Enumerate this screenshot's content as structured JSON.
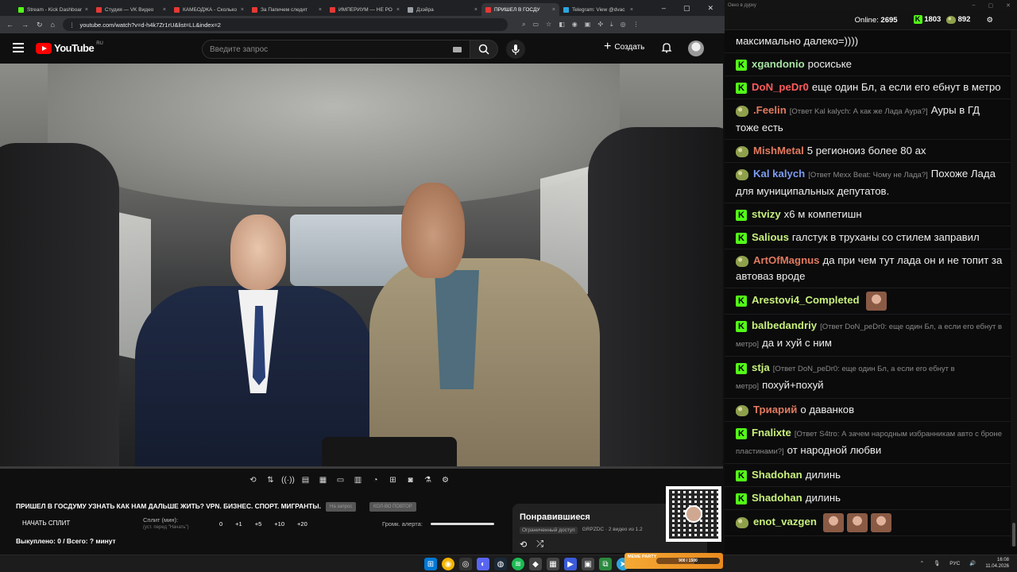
{
  "browser": {
    "tabs": [
      {
        "title": "Stream - Kick Dashboard",
        "color": "#53fc18",
        "active": false
      },
      {
        "title": "Студия — VK Видео",
        "color": "#e53935",
        "active": false
      },
      {
        "title": "КАМБОДЖА - Сколько",
        "color": "#e53935",
        "active": false
      },
      {
        "title": "За Папичем следит",
        "color": "#e53935",
        "active": false
      },
      {
        "title": "ИМПЕРИУМ — НЕ РО",
        "color": "#e53935",
        "active": false
      },
      {
        "title": "Дзэйра",
        "color": "#9aa0a6",
        "active": false
      },
      {
        "title": "ПРИШЕЛ В ГОСДУ",
        "color": "#e53935",
        "active": true
      },
      {
        "title": "Telegram: View @dvac",
        "color": "#2ca5e0",
        "active": false
      }
    ],
    "url": "youtube.com/watch?v=d-h4k7Zr1rU&list=LL&index=2"
  },
  "youtube": {
    "logo_text": "YouTube",
    "region": "RU",
    "search_placeholder": "Введите запрос",
    "create_label": "Создать"
  },
  "player": {
    "title": "ПРИШЕЛ В ГОСДУМУ УЗНАТЬ КАК НАМ ДАЛЬШЕ ЖИТЬ? VPN. БИЗНЕС. СПОРТ. МИГРАНТЫ.",
    "btn_ghost1": "На запрос",
    "btn_ghost2": "КОЛ-ВО ПОВТОР",
    "split_button": "НАЧАТЬ СПЛИТ",
    "split_label": "Сплит (мин):",
    "split_sub": "(уст. перед \"Начать\")",
    "split_values": [
      "0",
      "+1",
      "+5",
      "+10",
      "+20"
    ],
    "alert_label": "Громк. алерта:",
    "bought": "Выкуплено: 0 / Всего: ? минут"
  },
  "liked": {
    "title": "Понравившиеся",
    "access": "Ограниченный доступ",
    "meta": "GRPZDC · 2 видео из 1.2"
  },
  "chat": {
    "window_title": "Окно в дурку",
    "online_label": "Online:",
    "online_count": "2695",
    "kick_count": "1803",
    "other_count": "892",
    "messages": [
      {
        "badge": "none",
        "user": "",
        "color": "#ffffff",
        "reply": "",
        "text": "максимально далеко=))))"
      },
      {
        "badge": "kick",
        "user": "xgandonio",
        "color": "#a6e3a1",
        "reply": "",
        "text": "росиське"
      },
      {
        "badge": "kick",
        "user": "DoN_peDr0",
        "color": "#ff5c5c",
        "reply": "",
        "text": "еще один Бл, а если его ебнут в метро"
      },
      {
        "badge": "pepe",
        "user": ".Feelin",
        "color": "#e07a5f",
        "reply": "[Ответ Kal kalych: А как же Лада Аура?]",
        "text": "Ауры в ГД тоже есть"
      },
      {
        "badge": "pepe",
        "user": "MishMetal",
        "color": "#e07a5f",
        "reply": "",
        "text": "5 регионоиз более 80 ах"
      },
      {
        "badge": "pepe",
        "user": "Kal kalych",
        "color": "#7c9cf0",
        "reply": "[Ответ Mexx Beat: Чому не Лада?]",
        "text": "Похоже Лада для муниципальных депутатов."
      },
      {
        "badge": "kick",
        "user": "stvizy",
        "color": "#c8f07c",
        "reply": "",
        "text": "х6 м компетишн"
      },
      {
        "badge": "kick",
        "user": "Salious",
        "color": "#c8f07c",
        "reply": "",
        "text": "галстук в труханы со стилем заправил"
      },
      {
        "badge": "pepe",
        "user": "ArtOfMagnus",
        "color": "#e07a5f",
        "reply": "",
        "text": "да при чем тут лада он и не топит за автоваз вроде"
      },
      {
        "badge": "kick",
        "user": "Arestovi4_Completed",
        "color": "#c8f07c",
        "reply": "",
        "text": "",
        "emote": true
      },
      {
        "badge": "kick",
        "user": "balbedandriy",
        "color": "#c8f07c",
        "reply": "[Ответ DoN_peDr0: еще один Бл, а если его ебнут в метро]",
        "text": "да и хуй с ним"
      },
      {
        "badge": "kick",
        "user": "stja",
        "color": "#c8f07c",
        "reply": "[Ответ DoN_peDr0: еще один Бл, а если его ебнут в метро]",
        "text": "похуй+похуй"
      },
      {
        "badge": "pepe",
        "user": "Триарий",
        "color": "#e07a5f",
        "reply": "",
        "text": "о даванков"
      },
      {
        "badge": "kick",
        "user": "Fnalixte",
        "color": "#c8f07c",
        "reply": "[Ответ S4tro: А зачем народным избранникам авто с броне пластинами?]",
        "text": "от народной любви"
      },
      {
        "badge": "kick",
        "user": "Shadohan",
        "color": "#c8f07c",
        "reply": "",
        "text": "дилинь"
      },
      {
        "badge": "kick",
        "user": "Shadohan",
        "color": "#c8f07c",
        "reply": "",
        "text": "дилинь"
      },
      {
        "badge": "pepe",
        "user": "enot_vazgen",
        "color": "#c8f07c",
        "reply": "",
        "text": "",
        "emote3": true
      }
    ]
  },
  "taskbar": {
    "meme_label": "MEME PARTY",
    "meme_progress": "900 / 1500",
    "meme_fill": 0.6,
    "lang": "РУС",
    "time": "16:08",
    "date": "11.04.2026"
  }
}
